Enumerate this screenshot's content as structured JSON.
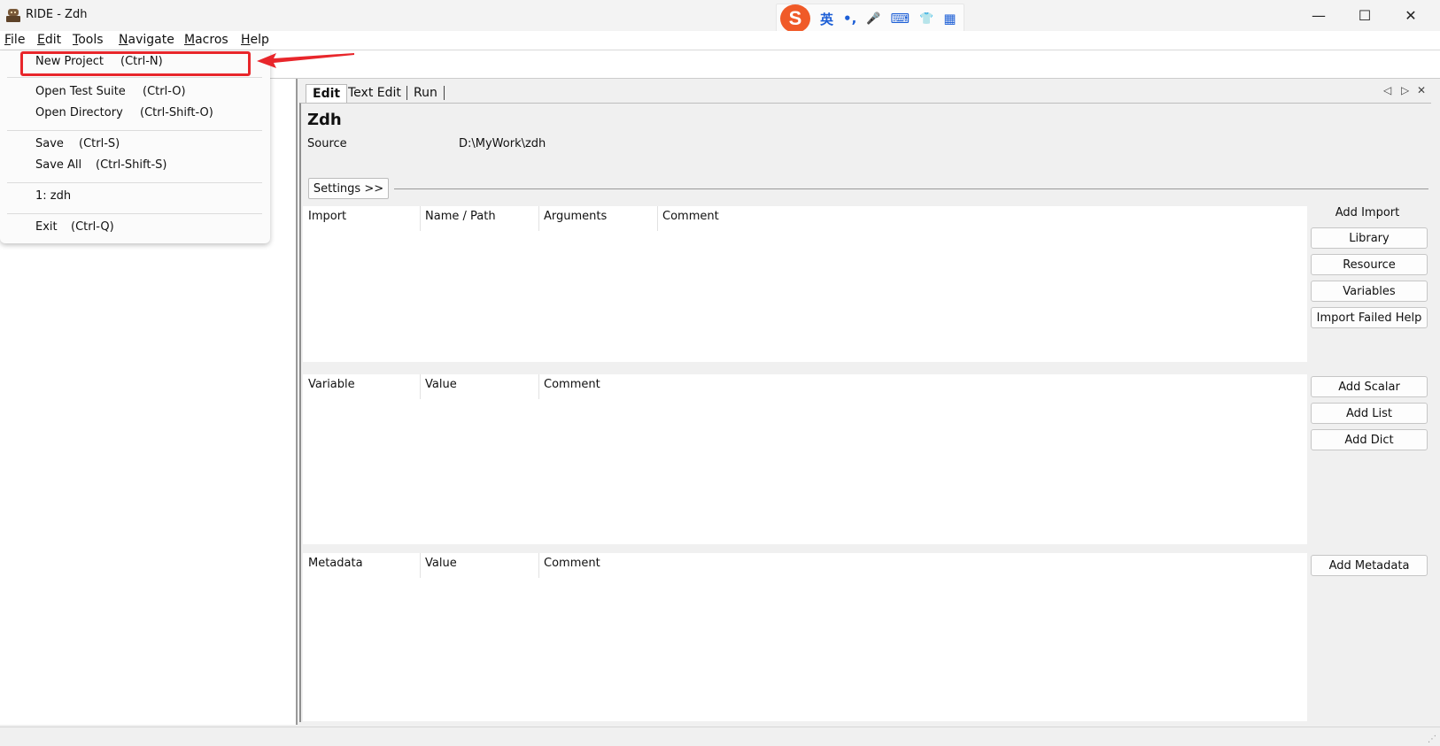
{
  "window": {
    "title": "RIDE - Zdh",
    "minimize": "—",
    "maximize": "☐",
    "close": "✕"
  },
  "ime": {
    "lang": "英",
    "punct": "•,",
    "mic": "🎤",
    "keyboard": "⌨",
    "skin": "👕",
    "apps": "▦"
  },
  "menubar": [
    "File",
    "Edit",
    "Tools",
    "Navigate",
    "Macros",
    "Help"
  ],
  "file_menu": {
    "new_project": {
      "label": "New Project",
      "shortcut": "(Ctrl-N)"
    },
    "open_test_suite": {
      "label": "Open Test Suite",
      "shortcut": "(Ctrl-O)"
    },
    "open_directory": {
      "label": "Open Directory",
      "shortcut": "(Ctrl-Shift-O)"
    },
    "save": {
      "label": "Save",
      "shortcut": "(Ctrl-S)"
    },
    "save_all": {
      "label": "Save All",
      "shortcut": "(Ctrl-Shift-S)"
    },
    "recent_1": {
      "label": "1: zdh"
    },
    "exit": {
      "label": "Exit",
      "shortcut": "(Ctrl-Q)"
    }
  },
  "tabs": [
    "Edit",
    "Text Edit",
    "Run"
  ],
  "tab_controls": {
    "prev": "◁",
    "next": "▷",
    "close": "✕"
  },
  "editor": {
    "suite_name": "Zdh",
    "source_label": "Source",
    "source_value": "D:\\MyWork\\zdh",
    "settings_button": "Settings >>",
    "import_table": {
      "headers": [
        "Import",
        "Name / Path",
        "Arguments",
        "Comment"
      ]
    },
    "import_actions": {
      "title": "Add Import",
      "buttons": [
        "Library",
        "Resource",
        "Variables",
        "Import Failed Help"
      ]
    },
    "variable_table": {
      "headers": [
        "Variable",
        "Value",
        "Comment"
      ]
    },
    "variable_actions": {
      "buttons": [
        "Add Scalar",
        "Add List",
        "Add Dict"
      ]
    },
    "metadata_table": {
      "headers": [
        "Metadata",
        "Value",
        "Comment"
      ]
    },
    "metadata_actions": {
      "buttons": [
        "Add Metadata"
      ]
    }
  },
  "colors": {
    "highlight": "#e8262b",
    "ime_logo": "#f05a28"
  }
}
